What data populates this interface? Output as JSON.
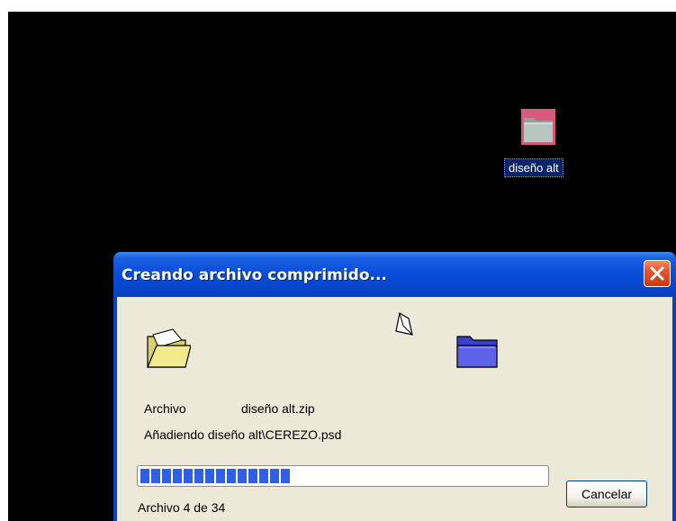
{
  "desktop": {
    "icon_label": "diseño alt",
    "icon": "folder-icon"
  },
  "dialog": {
    "title": "Creando archivo comprimido...",
    "close_icon": "close-icon",
    "source_icon": "folder-open-icon",
    "dest_icon": "folder-icon",
    "anim_icon": "flying-paper-icon",
    "file_label": "Archivo",
    "file_name": "diseño alt.zip",
    "status": "Añadiendo diseño alt\\CEREZO.psd",
    "progress_count": "Archivo 4 de 34",
    "progress_fraction": 0.37,
    "cancel_label": "Cancelar"
  },
  "colors": {
    "titlebar": "#0b50db",
    "progress": "#2f5fe3",
    "dialog_bg": "#ece9d8",
    "selection": "#0a246a"
  }
}
